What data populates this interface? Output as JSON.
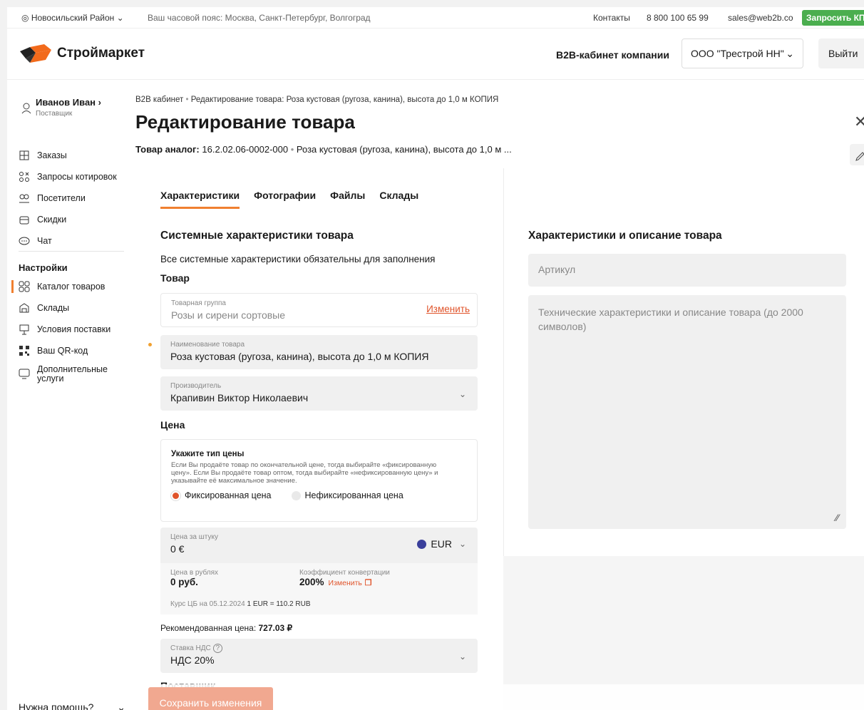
{
  "topbar": {
    "location": "Новосильский Район",
    "timezone": "Ваш часовой пояс: Москва, Санкт-Петербург, Волгоград",
    "contacts": "Контакты",
    "phone": "8 800 100 65 99",
    "email": "sales@web2b.co",
    "request_kp": "Запросить КП"
  },
  "header": {
    "logo": "Строймаркет",
    "b2b_label": "B2B-кабинет компании",
    "company": "ООО \"Трестрой НН\"",
    "logout": "Выйти"
  },
  "sidebar": {
    "user_name": "Иванов Иван",
    "user_role": "Поставщик",
    "items": [
      {
        "label": "Заказы",
        "icon": "orders-icon"
      },
      {
        "label": "Запросы котировок",
        "icon": "quotes-icon"
      },
      {
        "label": "Посетители",
        "icon": "visitors-icon"
      },
      {
        "label": "Скидки",
        "icon": "discount-icon"
      },
      {
        "label": "Чат",
        "icon": "chat-icon"
      }
    ],
    "settings_heading": "Настройки",
    "settings_items": [
      {
        "label": "Каталог товаров",
        "icon": "catalog-icon"
      },
      {
        "label": "Склады",
        "icon": "warehouse-icon"
      },
      {
        "label": "Условия поставки",
        "icon": "delivery-icon"
      },
      {
        "label": "Ваш QR-код",
        "icon": "qr-icon"
      },
      {
        "label": "Дополнительные услуги",
        "icon": "monitor-icon"
      }
    ],
    "help": "Нужна помощь?"
  },
  "main": {
    "breadcrumb_root": "B2B кабинет",
    "breadcrumb_current": "Редактирование товара: Роза кустовая (ругоза, канина), высота до 1,0 м КОПИЯ",
    "title": "Редактирование товара",
    "analog_label": "Товар аналог:",
    "analog_code": "16.2.02.06-0002-000",
    "analog_name": "Роза кустовая (ругоза, канина), высота до 1,0 м ...",
    "tabs": [
      "Характеристики",
      "Фотографии",
      "Файлы",
      "Склады"
    ],
    "system_heading": "Системные характеристики товара",
    "system_note": "Все системные характеристики обязательны для заполнения",
    "product_heading": "Товар",
    "group_label": "Товарная группа",
    "group_value": "Розы и сирени сортовые",
    "group_change": "Изменить",
    "name_label": "Наименование товара",
    "name_value": "Роза кустовая (ругоза, канина), высота до 1,0 м КОПИЯ",
    "maker_label": "Производитель",
    "maker_value": "Крапивин Виктор Николаевич",
    "price_heading": "Цена",
    "price_type_heading": "Укажите тип цены",
    "price_type_desc": "Если Вы продаёте товар по окончательной цене, тогда выбирайте «фиксированную цену». Если Вы продаёте товар оптом, тогда выбирайте «нефиксированную цену» и указывайте её максимальное значение.",
    "price_fixed": "Фиксированная цена",
    "price_unfixed": "Нефиксированная цена",
    "unit_price_label": "Цена за штуку",
    "unit_price_value": "0 €",
    "currency": "EUR",
    "rub_label": "Цена в рублях",
    "rub_value": "0 руб.",
    "coef_label": "Коэффициент конвертации",
    "coef_value": "200%",
    "coef_change": "Изменить",
    "rate_prefix": "Курс ЦБ на 05.12.2024",
    "rate_value": "1 EUR = 110.2 RUB",
    "reco_label": "Рекомендованная цена:",
    "reco_value": "727.03 ₽",
    "vat_label": "Ставка НДС",
    "vat_value": "НДС 20%",
    "supplier_heading": "Поставщик",
    "save": "Сохранить изменения",
    "right_heading": "Характеристики и описание товара",
    "article_placeholder": "Артикул",
    "desc_placeholder": "Технические характеристики и описание товара (до 2000 символов)"
  }
}
